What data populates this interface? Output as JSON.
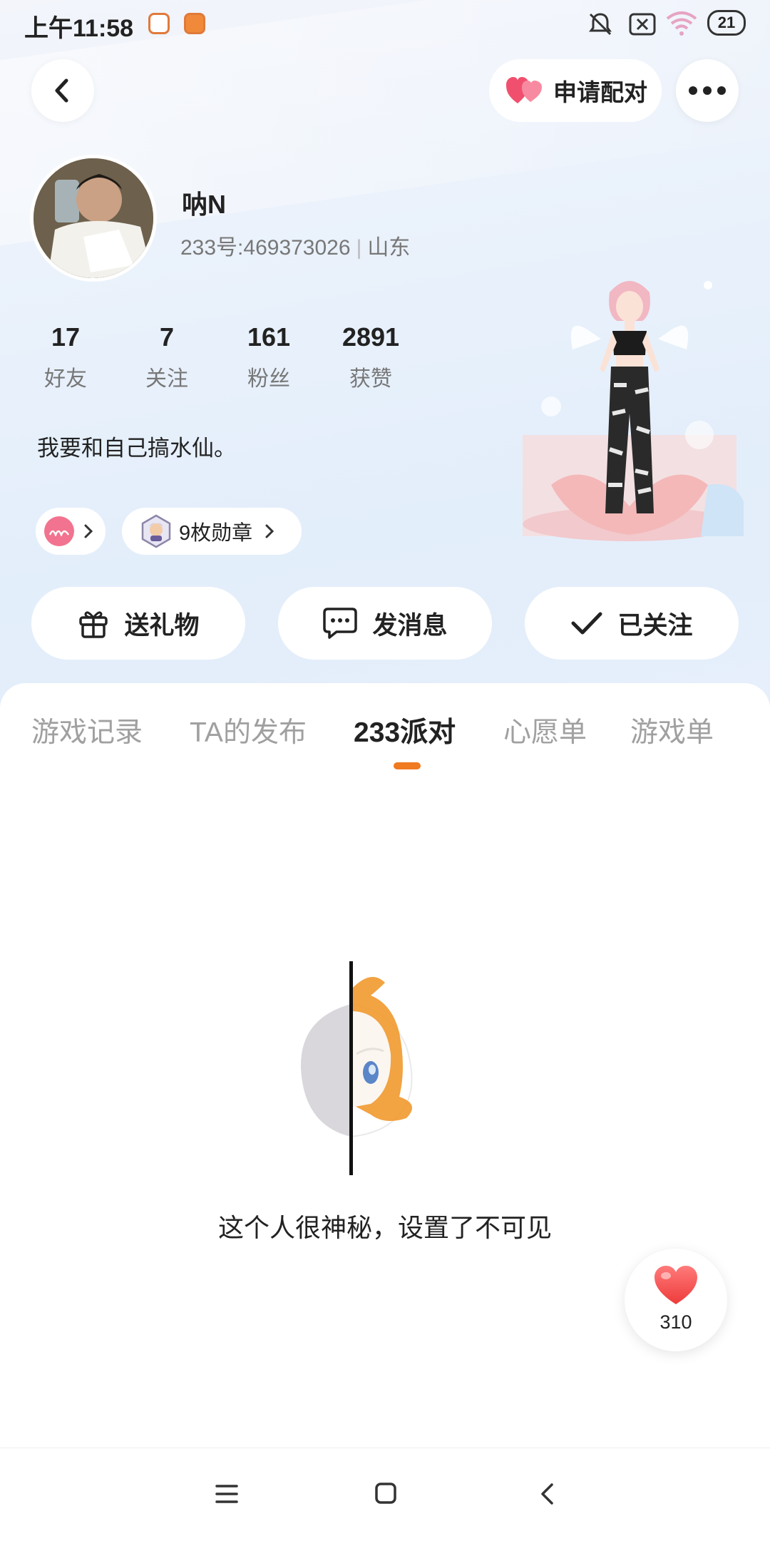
{
  "status_bar": {
    "time": "上午11:58",
    "battery": "21"
  },
  "header": {
    "pair_label": "申请配对"
  },
  "profile": {
    "name": "呐N",
    "id_text": "233号:469373026",
    "region": "山东",
    "bio": "我要和自己搞水仙。"
  },
  "stats": [
    {
      "value": "17",
      "label": "好友"
    },
    {
      "value": "7",
      "label": "关注"
    },
    {
      "value": "161",
      "label": "粉丝"
    },
    {
      "value": "2891",
      "label": "获赞"
    }
  ],
  "chips": {
    "badge_label": "9枚勋章"
  },
  "actions": {
    "gift": "送礼物",
    "message": "发消息",
    "followed": "已关注"
  },
  "tabs": [
    {
      "label": "游戏记录",
      "active": false
    },
    {
      "label": "TA的发布",
      "active": false
    },
    {
      "label": "233派对",
      "active": true
    },
    {
      "label": "心愿单",
      "active": false
    },
    {
      "label": "游戏单",
      "active": false
    }
  ],
  "empty_state": {
    "message": "这个人很神秘，设置了不可见"
  },
  "like": {
    "count": "310"
  },
  "colors": {
    "accent": "#f07a20",
    "heart": "#f0506e"
  }
}
